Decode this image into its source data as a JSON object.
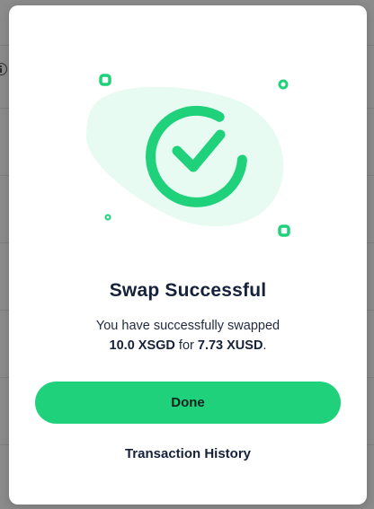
{
  "modal": {
    "title": "Swap Successful",
    "message_line1": "You have successfully swapped",
    "from_amount": "10.0 XSGD",
    "message_connector": " for ",
    "to_amount": "7.73 XUSD",
    "message_end": ".",
    "done_label": "Done",
    "history_label": "Transaction History"
  },
  "colors": {
    "accent": "#1fd17b",
    "blob": "#e8fbf2",
    "text": "#16213a"
  },
  "icons": {
    "hero": "check-circle-icon",
    "background_info": "info-icon"
  }
}
